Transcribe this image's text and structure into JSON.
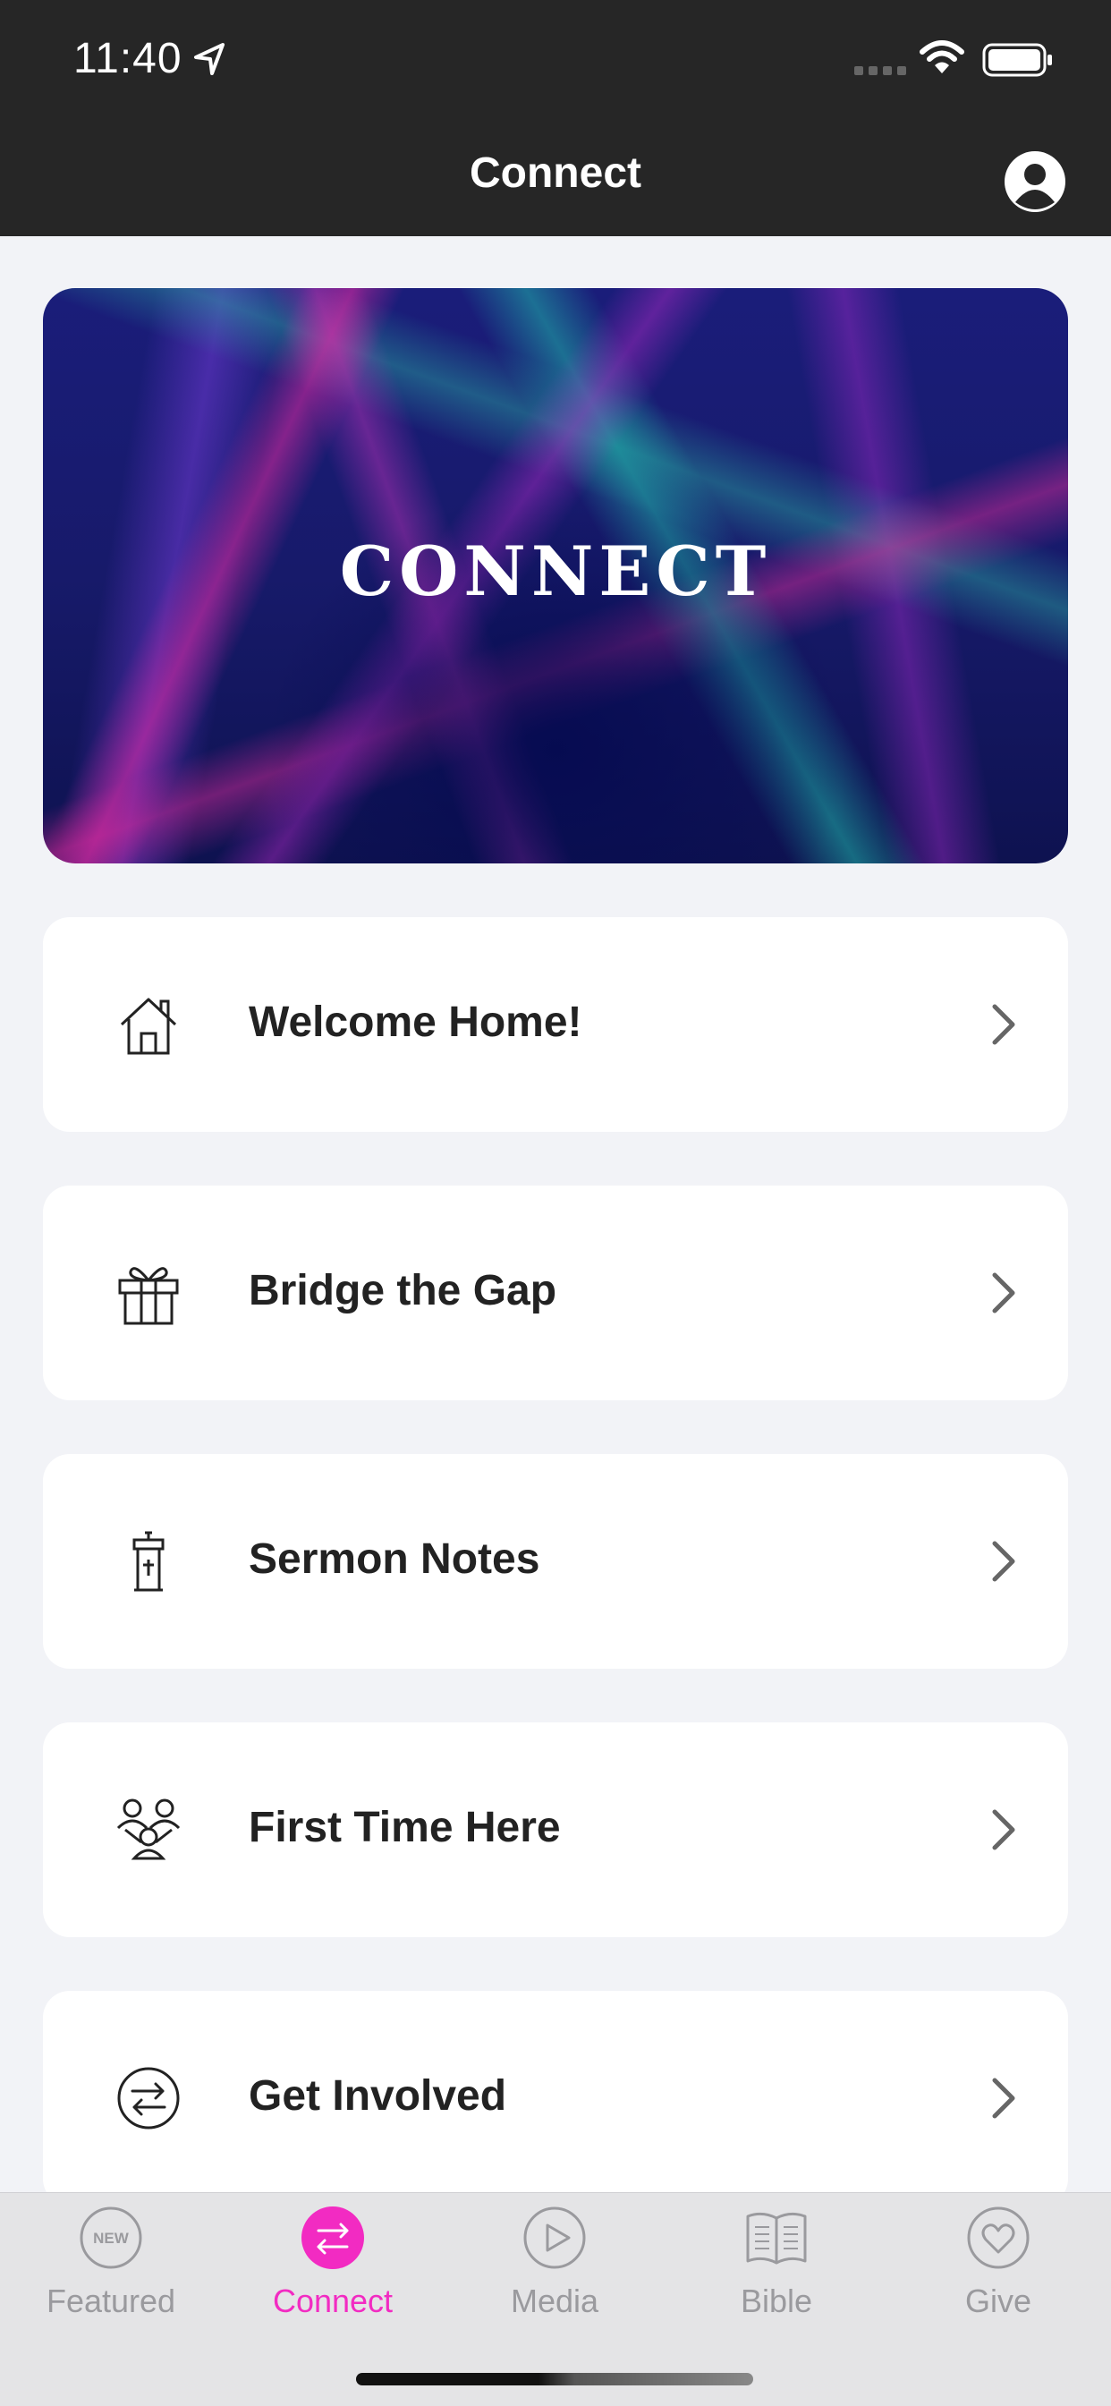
{
  "status_bar": {
    "time": "11:40",
    "icons": [
      "location-arrow-icon",
      "signal-icon",
      "wifi-icon",
      "battery-icon"
    ]
  },
  "nav": {
    "title": "Connect",
    "profile_icon": "profile-icon"
  },
  "banner": {
    "text": "CONNECT"
  },
  "items": [
    {
      "label": "Welcome Home!",
      "icon": "house-icon"
    },
    {
      "label": "Bridge the Gap",
      "icon": "gift-icon"
    },
    {
      "label": "Sermon Notes",
      "icon": "pulpit-icon"
    },
    {
      "label": "First Time Here",
      "icon": "people-icon"
    },
    {
      "label": "Get Involved",
      "icon": "exchange-icon"
    }
  ],
  "tabs": [
    {
      "label": "Featured",
      "icon": "new-badge-icon",
      "badge": "NEW",
      "active": false
    },
    {
      "label": "Connect",
      "icon": "exchange-icon",
      "active": true
    },
    {
      "label": "Media",
      "icon": "play-icon",
      "active": false
    },
    {
      "label": "Bible",
      "icon": "book-icon",
      "active": false
    },
    {
      "label": "Give",
      "icon": "heart-icon",
      "active": false
    }
  ],
  "colors": {
    "header_bg": "#262626",
    "accent": "#f22bc2",
    "page_bg": "#f2f3f7",
    "card_bg": "#ffffff"
  }
}
